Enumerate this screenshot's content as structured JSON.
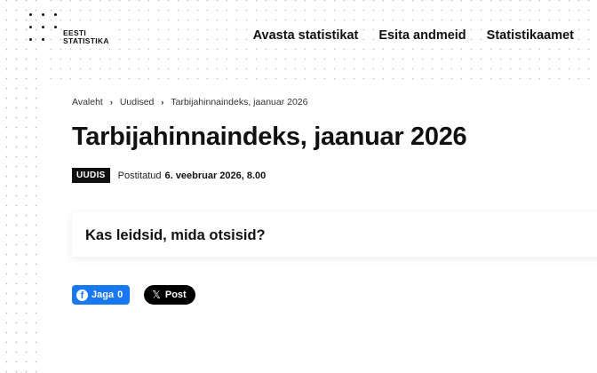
{
  "logo": {
    "line1": "EESTI",
    "line2": "STATISTIKA"
  },
  "nav": {
    "items": [
      {
        "label": "Avasta statistikat"
      },
      {
        "label": "Esita andmeid"
      },
      {
        "label": "Statistikaamet"
      }
    ]
  },
  "breadcrumb": {
    "items": [
      {
        "label": "Avaleht"
      },
      {
        "label": "Uudised"
      },
      {
        "label": "Tarbijahinnaindeks, jaanuar 2026"
      }
    ],
    "separator": "›"
  },
  "article": {
    "title": "Tarbijahinnaindeks, jaanuar 2026",
    "badge": "UUDIS",
    "posted_label": "Postitatud",
    "posted_date": "6. veebruar 2026, 8.00"
  },
  "feedback": {
    "question": "Kas leidsid, mida otsisid?"
  },
  "share": {
    "facebook_label": "Jaga",
    "facebook_count": "0",
    "facebook_icon": "f",
    "x_label": "Post",
    "x_icon": "𝕏"
  }
}
